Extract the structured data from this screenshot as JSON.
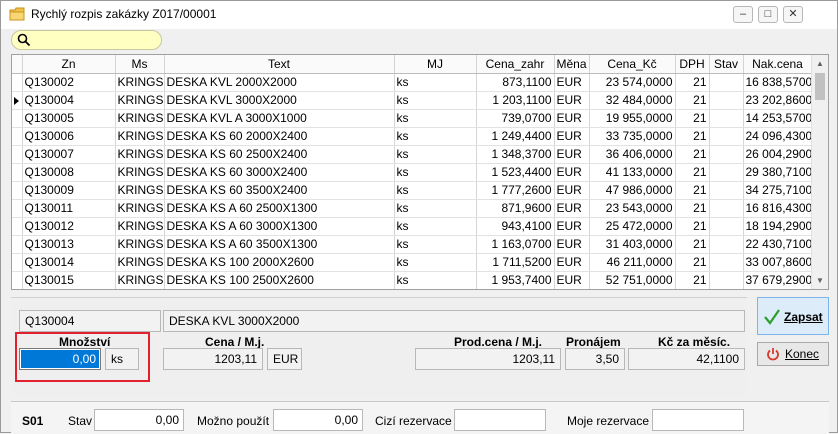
{
  "window": {
    "title": "Rychlý rozpis zakázky Z017/00001"
  },
  "grid": {
    "columns": [
      "Zn",
      "Ms",
      "Text",
      "MJ",
      "Cena_zahr",
      "Měna",
      "Cena_Kč",
      "DPH",
      "Stav",
      "Nak.cena"
    ],
    "rows": [
      {
        "zn": "Q130002",
        "ms": "KRINGS",
        "text": "DESKA KVL 2000X2000",
        "mj": "ks",
        "cena_zahr": "873,1100",
        "mena": "EUR",
        "cena_kc": "23 574,0000",
        "dph": "21",
        "stav": "",
        "nak_cena": "16 838,5700"
      },
      {
        "zn": "Q130004",
        "ms": "KRINGS",
        "text": "DESKA KVL 3000X2000",
        "mj": "ks",
        "cena_zahr": "1 203,1100",
        "mena": "EUR",
        "cena_kc": "32 484,0000",
        "dph": "21",
        "stav": "",
        "nak_cena": "23 202,8600"
      },
      {
        "zn": "Q130005",
        "ms": "KRINGS",
        "text": "DESKA KVL A 3000X1000",
        "mj": "ks",
        "cena_zahr": "739,0700",
        "mena": "EUR",
        "cena_kc": "19 955,0000",
        "dph": "21",
        "stav": "",
        "nak_cena": "14 253,5700"
      },
      {
        "zn": "Q130006",
        "ms": "KRINGS",
        "text": "DESKA KS 60 2000X2400",
        "mj": "ks",
        "cena_zahr": "1 249,4400",
        "mena": "EUR",
        "cena_kc": "33 735,0000",
        "dph": "21",
        "stav": "",
        "nak_cena": "24 096,4300"
      },
      {
        "zn": "Q130007",
        "ms": "KRINGS",
        "text": "DESKA KS 60 2500X2400",
        "mj": "ks",
        "cena_zahr": "1 348,3700",
        "mena": "EUR",
        "cena_kc": "36 406,0000",
        "dph": "21",
        "stav": "",
        "nak_cena": "26 004,2900"
      },
      {
        "zn": "Q130008",
        "ms": "KRINGS",
        "text": "DESKA KS 60 3000X2400",
        "mj": "ks",
        "cena_zahr": "1 523,4400",
        "mena": "EUR",
        "cena_kc": "41 133,0000",
        "dph": "21",
        "stav": "",
        "nak_cena": "29 380,7100"
      },
      {
        "zn": "Q130009",
        "ms": "KRINGS",
        "text": "DESKA KS 60 3500X2400",
        "mj": "ks",
        "cena_zahr": "1 777,2600",
        "mena": "EUR",
        "cena_kc": "47 986,0000",
        "dph": "21",
        "stav": "",
        "nak_cena": "34 275,7100"
      },
      {
        "zn": "Q130011",
        "ms": "KRINGS",
        "text": "DESKA KS A 60 2500X1300",
        "mj": "ks",
        "cena_zahr": "871,9600",
        "mena": "EUR",
        "cena_kc": "23 543,0000",
        "dph": "21",
        "stav": "",
        "nak_cena": "16 816,4300"
      },
      {
        "zn": "Q130012",
        "ms": "KRINGS",
        "text": "DESKA KS A 60 3000X1300",
        "mj": "ks",
        "cena_zahr": "943,4100",
        "mena": "EUR",
        "cena_kc": "25 472,0000",
        "dph": "21",
        "stav": "",
        "nak_cena": "18 194,2900"
      },
      {
        "zn": "Q130013",
        "ms": "KRINGS",
        "text": "DESKA KS A 60 3500X1300",
        "mj": "ks",
        "cena_zahr": "1 163,0700",
        "mena": "EUR",
        "cena_kc": "31 403,0000",
        "dph": "21",
        "stav": "",
        "nak_cena": "22 430,7100"
      },
      {
        "zn": "Q130014",
        "ms": "KRINGS",
        "text": "DESKA KS 100 2000X2600",
        "mj": "ks",
        "cena_zahr": "1 711,5200",
        "mena": "EUR",
        "cena_kc": "46 211,0000",
        "dph": "21",
        "stav": "",
        "nak_cena": "33 007,8600"
      },
      {
        "zn": "Q130015",
        "ms": "KRINGS",
        "text": "DESKA KS 100 2500X2600",
        "mj": "ks",
        "cena_zahr": "1 953,7400",
        "mena": "EUR",
        "cena_kc": "52 751,0000",
        "dph": "21",
        "stav": "",
        "nak_cena": "37 679,2900"
      }
    ]
  },
  "detail": {
    "code": "Q130004",
    "name": "DESKA KVL 3000X2000",
    "mnozstvi_label": "Množství",
    "mnozstvi_value": "0,00",
    "mnozstvi_unit": "ks",
    "cena_label": "Cena / M.j.",
    "cena_value": "1203,11",
    "cena_currency": "EUR",
    "prod_label": "Prod.cena / M.j.",
    "prod_value": "1203,11",
    "pronajem_label": "Pronájem",
    "pronajem_value": "3,50",
    "kc_label": "Kč za měsíc.",
    "kc_value": "42,1100"
  },
  "buttons": {
    "zapsat": "Zapsat",
    "konec": "Konec"
  },
  "status": {
    "code": "S01",
    "stav_label": "Stav",
    "stav_value": "0,00",
    "mozno_label": "Možno použít",
    "mozno_value": "0,00",
    "cizi_label": "Cizí rezervace",
    "cizi_value": "",
    "moje_label": "Moje rezervace",
    "moje_value": ""
  },
  "colors": {
    "search_bg": "#ffffc2",
    "selection": "#0078d7",
    "highlight_frame": "#e2212f",
    "zapsat_icon": "#2e9e2e",
    "konec_icon": "#d83a2e"
  },
  "icons": {
    "search": "search-icon",
    "row_pointer": "row-pointer-icon",
    "zapsat": "checkmark-icon",
    "konec": "power-icon"
  }
}
